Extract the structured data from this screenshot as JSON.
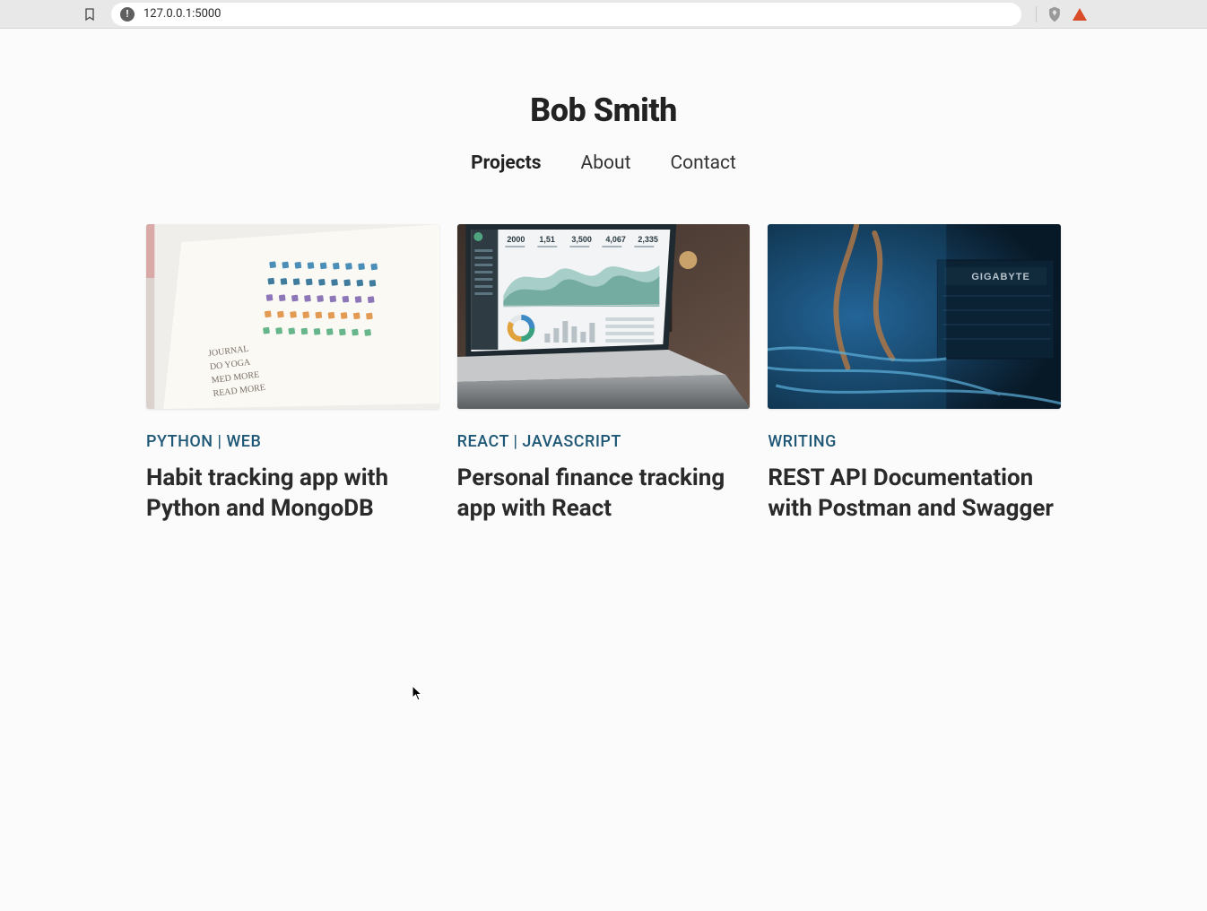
{
  "browser": {
    "url": "127.0.0.1:5000"
  },
  "header": {
    "title": "Bob Smith"
  },
  "nav": {
    "items": [
      {
        "label": "Projects",
        "active": true
      },
      {
        "label": "About",
        "active": false
      },
      {
        "label": "Contact",
        "active": false
      }
    ]
  },
  "projects": [
    {
      "tags": "PYTHON | WEB",
      "title": "Habit tracking app with Python and MongoDB",
      "image": "notebook-habit-tracker"
    },
    {
      "tags": "REACT | JAVASCRIPT",
      "title": "Personal finance tracking app with React",
      "image": "laptop-dashboard"
    },
    {
      "tags": "WRITING",
      "title": "REST API Documentation with Postman and Swagger",
      "image": "pc-internals"
    }
  ]
}
